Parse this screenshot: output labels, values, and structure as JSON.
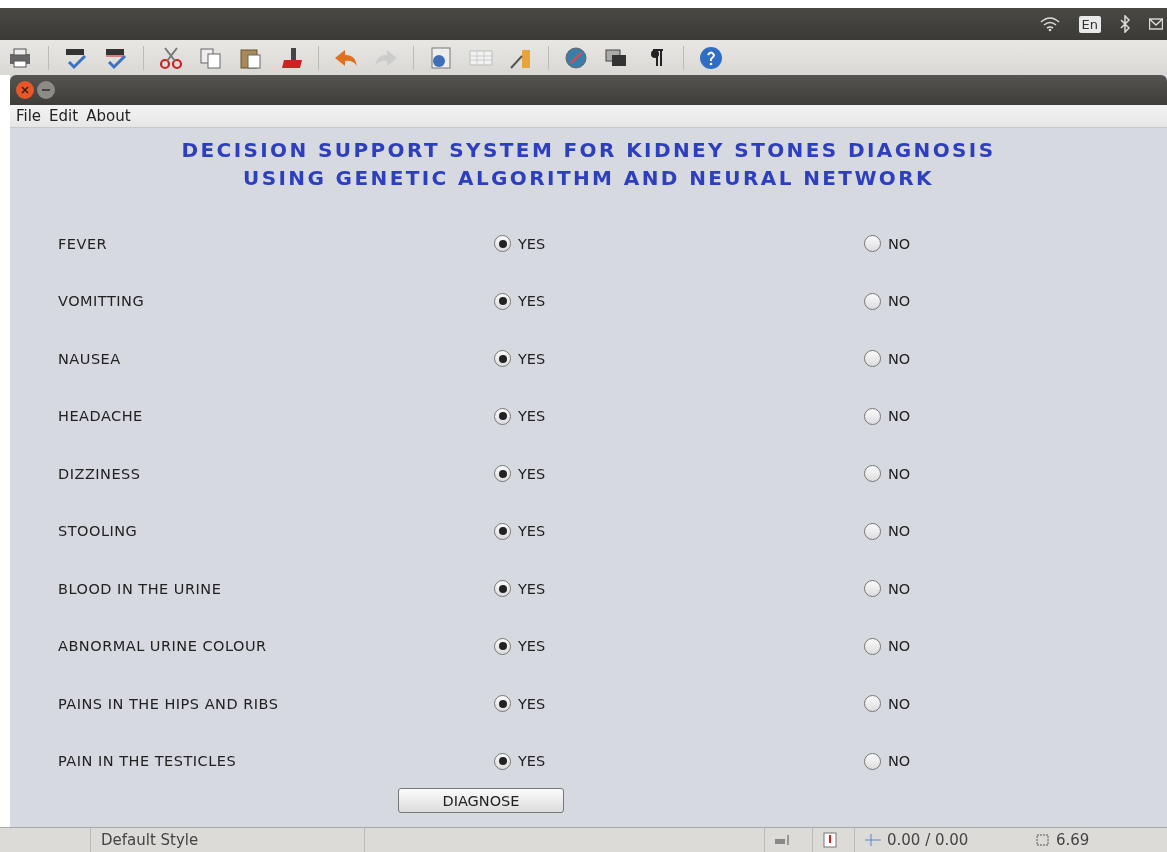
{
  "system_bar": {
    "keyboard": "En"
  },
  "window": {
    "menu": [
      "File",
      "Edit",
      "About"
    ],
    "title_lines": [
      "DECISION SUPPORT SYSTEM FOR KIDNEY STONES DIAGNOSIS",
      "USING GENETIC ALGORITHM AND NEURAL NETWORK"
    ],
    "questions": [
      {
        "label": "FEVER",
        "options": [
          {
            "label": "YES",
            "selected": true
          },
          {
            "label": "NO",
            "selected": false
          }
        ]
      },
      {
        "label": "VOMITTING",
        "options": [
          {
            "label": "YES",
            "selected": true
          },
          {
            "label": "NO",
            "selected": false
          }
        ]
      },
      {
        "label": "NAUSEA",
        "options": [
          {
            "label": "YES",
            "selected": true
          },
          {
            "label": "NO",
            "selected": false
          }
        ]
      },
      {
        "label": "HEADACHE",
        "options": [
          {
            "label": "YES",
            "selected": true
          },
          {
            "label": "NO",
            "selected": false
          }
        ]
      },
      {
        "label": "DIZZINESS",
        "options": [
          {
            "label": "YES",
            "selected": true
          },
          {
            "label": "NO",
            "selected": false
          }
        ]
      },
      {
        "label": "STOOLING",
        "options": [
          {
            "label": "YES",
            "selected": true
          },
          {
            "label": "NO",
            "selected": false
          }
        ]
      },
      {
        "label": "BLOOD IN THE URINE",
        "options": [
          {
            "label": "YES",
            "selected": true
          },
          {
            "label": "NO",
            "selected": false
          }
        ]
      },
      {
        "label": "ABNORMAL URINE COLOUR",
        "options": [
          {
            "label": "YES",
            "selected": true
          },
          {
            "label": "NO",
            "selected": false
          }
        ]
      },
      {
        "label": "PAINS IN THE HIPS AND RIBS",
        "options": [
          {
            "label": "YES",
            "selected": true
          },
          {
            "label": "NO",
            "selected": false
          }
        ]
      },
      {
        "label": "PAIN IN THE TESTICLES",
        "options": [
          {
            "label": "YES",
            "selected": true
          },
          {
            "label": "NO",
            "selected": false
          }
        ]
      }
    ],
    "button": "DIAGNOSE"
  },
  "status_bar": {
    "style": "Default Style",
    "position": "0.00 / 0.00",
    "size": "6.69"
  }
}
